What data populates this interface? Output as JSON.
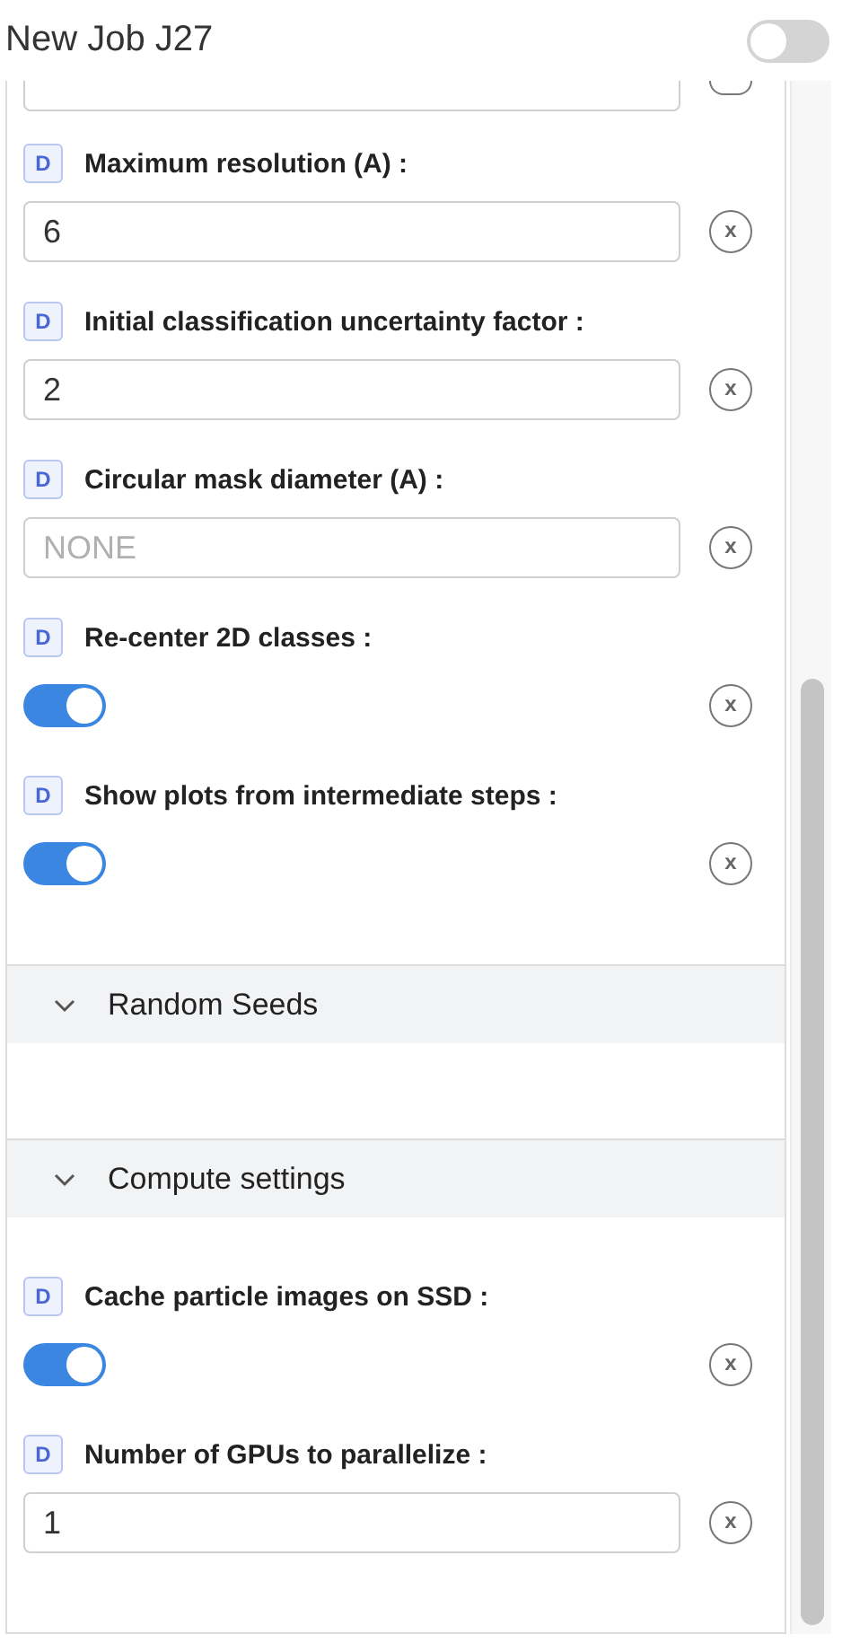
{
  "header": {
    "title": "New Job J27",
    "enabled": false
  },
  "sections": [
    {
      "params": [
        {
          "kind": "cut-field"
        },
        {
          "kind": "field",
          "badge": "D",
          "label": "Maximum resolution (A) :",
          "value": "6",
          "clear": "x"
        },
        {
          "kind": "field",
          "badge": "D",
          "label": "Initial classification uncertainty factor :",
          "value": "2",
          "clear": "x"
        },
        {
          "kind": "field",
          "badge": "D",
          "label": "Circular mask diameter (A) :",
          "placeholder": "NONE",
          "clear": "x"
        },
        {
          "kind": "toggle",
          "badge": "D",
          "label": "Re-center 2D classes :",
          "on": true,
          "clear": "x"
        },
        {
          "kind": "toggle",
          "badge": "D",
          "label": "Show plots from intermediate steps :",
          "on": true,
          "clear": "x"
        }
      ]
    },
    {
      "title": "Random Seeds",
      "expanded": true
    },
    {
      "title": "Compute settings",
      "expanded": true,
      "params": [
        {
          "kind": "toggle",
          "badge": "D",
          "label": "Cache particle images on SSD :",
          "on": true,
          "clear": "x"
        },
        {
          "kind": "field",
          "badge": "D",
          "label": "Number of GPUs to parallelize :",
          "value": "1",
          "clear": "x"
        }
      ]
    }
  ]
}
